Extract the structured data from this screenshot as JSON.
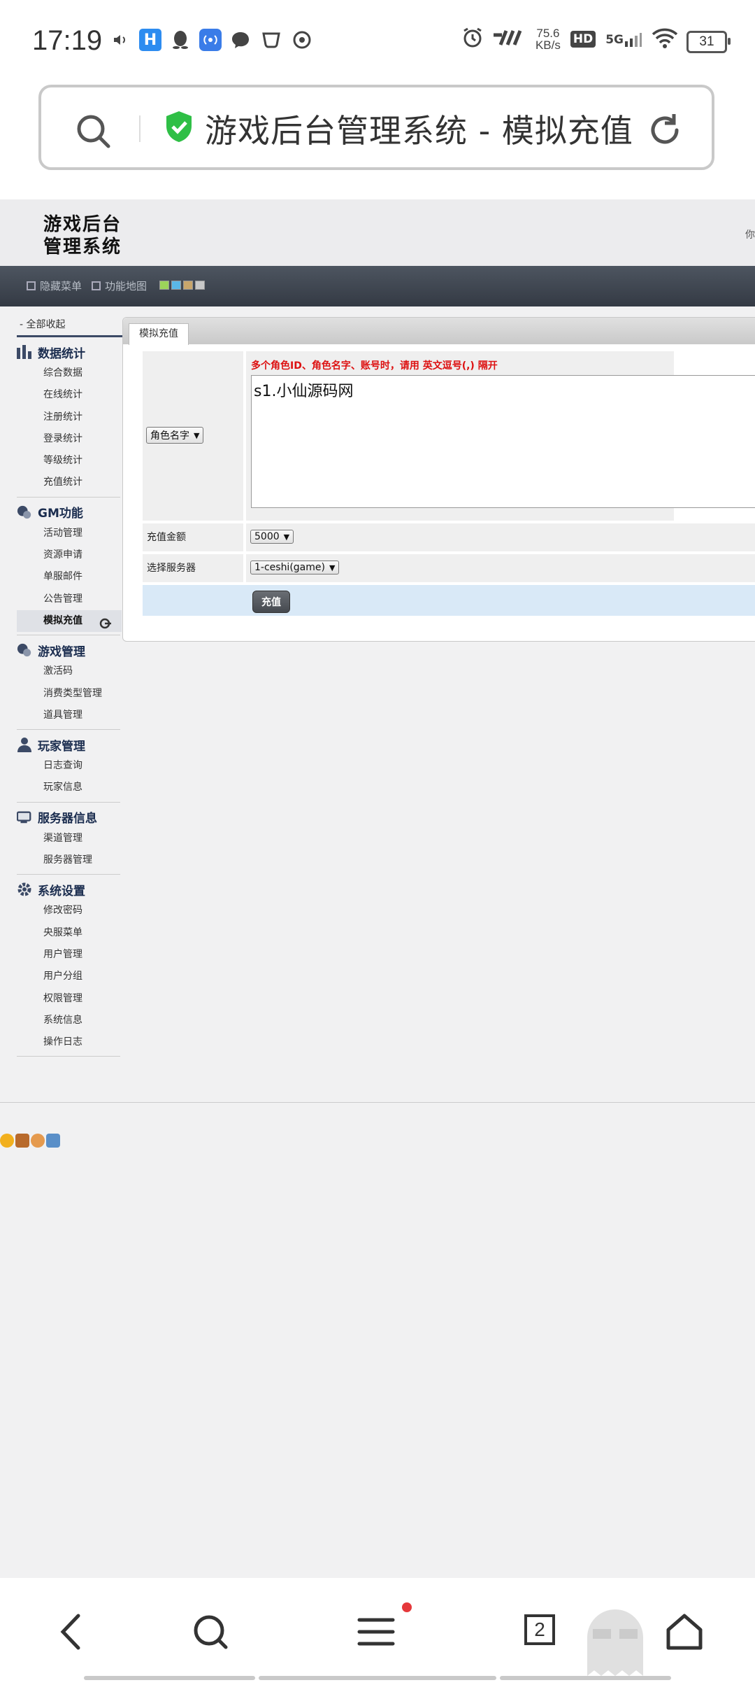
{
  "status_bar": {
    "time": "17:19",
    "net_speed_value": "75.6",
    "net_speed_unit": "KB/s",
    "hd_label": "HD",
    "network_label": "5G",
    "battery_level": "31"
  },
  "browser": {
    "page_title": "游戏后台管理系统 - 模拟充值"
  },
  "site": {
    "logo_line1": "游戏后台",
    "logo_line2": "管理系统",
    "header_right_text": "你",
    "toolbar": {
      "hide_menu": "隐藏菜单",
      "function_map": "功能地图"
    },
    "theme_colors": [
      "#9cd35a",
      "#5ab7e6",
      "#c9a66b",
      "#c8c8c8"
    ]
  },
  "sidebar": {
    "collapse_all": "- 全部收起",
    "groups": [
      {
        "title": "数据统计",
        "icon": "bar-chart-icon",
        "items": [
          "综合数据",
          "在线统计",
          "注册统计",
          "登录统计",
          "等级统计",
          "充值统计"
        ]
      },
      {
        "title": "GM功能",
        "icon": "gm-icon",
        "items": [
          "活动管理",
          "资源申请",
          "单服邮件",
          "公告管理",
          "模拟充值"
        ]
      },
      {
        "title": "游戏管理",
        "icon": "game-icon",
        "items": [
          "激活码",
          "消费类型管理",
          "道具管理"
        ]
      },
      {
        "title": "玩家管理",
        "icon": "user-icon",
        "items": [
          "日志查询",
          "玩家信息"
        ]
      },
      {
        "title": "服务器信息",
        "icon": "server-icon",
        "items": [
          "渠道管理",
          "服务器管理"
        ]
      },
      {
        "title": "系统设置",
        "icon": "gear-icon",
        "items": [
          "修改密码",
          "央服菜单",
          "用户管理",
          "用户分组",
          "权限管理",
          "系统信息",
          "操作日志"
        ]
      }
    ],
    "active_item": "模拟充值"
  },
  "panel": {
    "tab_label": "模拟充值",
    "role_select_value": "角色名字",
    "hint": "多个角色ID、角色名字、账号时，请用 英文逗号(,) 隔开",
    "textarea_value": "s1.小仙源码网",
    "amount_label": "充值金额",
    "amount_value": "5000",
    "server_label": "选择服务器",
    "server_value": "1-ceshi(game)",
    "submit_label": "充值"
  }
}
